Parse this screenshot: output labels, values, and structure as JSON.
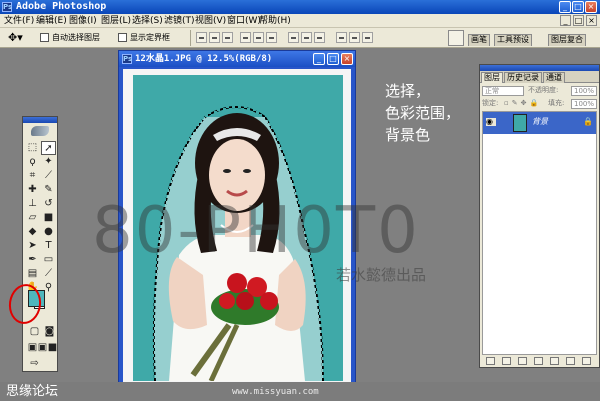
{
  "app": {
    "title": "Adobe Photoshop",
    "title_controls": [
      "_",
      "□",
      "×"
    ]
  },
  "menu": {
    "items": [
      "文件(F)",
      "编辑(E)",
      "图像(I)",
      "图层(L)",
      "选择(S)",
      "滤镜(T)",
      "视图(V)",
      "窗口(W)",
      "帮助(H)"
    ],
    "doc_controls": [
      "_",
      "□",
      "×"
    ]
  },
  "options": {
    "auto_select_layer": "自动选择图层",
    "show_bounding_box": "显示定界框",
    "palette_tabs": [
      "画笔",
      "工具预设",
      "图层复合"
    ]
  },
  "document": {
    "title": "12水晶1.JPG @ 12.5%(RGB/8)",
    "controls": [
      "_",
      "□",
      "×"
    ]
  },
  "hint": {
    "lines": [
      "选择，",
      "色彩范围，",
      "背景色"
    ]
  },
  "layers_panel": {
    "tabs": [
      "图层",
      "历史记录",
      "通道"
    ],
    "blend_mode": "正常",
    "opacity_label": "不透明度:",
    "opacity_value": "100%",
    "lock_label": "锁定:",
    "fill_label": "填充:",
    "fill_value": "100%",
    "layers": [
      {
        "name": "背景"
      }
    ]
  },
  "watermark": {
    "big": "80-PH0T0",
    "small": "若水懿德出品"
  },
  "footer": {
    "left": "思缘论坛",
    "right": "www.missyuan.com"
  },
  "colors": {
    "foreground_swatch": "#4fb6bd",
    "background_swatch": "#ffffff",
    "photo_background": "#3fa9a8",
    "highlight_circle": "#e10000"
  }
}
